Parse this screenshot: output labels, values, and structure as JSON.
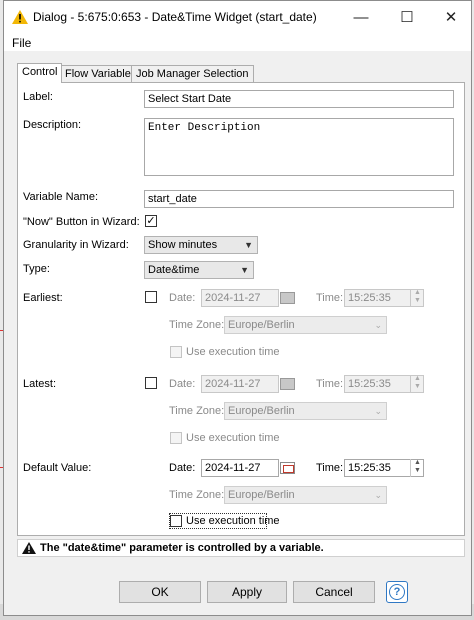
{
  "window": {
    "title": "Dialog - 5:675:0:653 - Date&Time Widget (start_date)",
    "minimize_glyph": "—",
    "maximize_glyph": "☐",
    "close_glyph": "✕"
  },
  "menu": {
    "file": "File"
  },
  "tabs": [
    "Control",
    "Flow Variables",
    "Job Manager Selection"
  ],
  "form": {
    "label_label": "Label:",
    "label_value": "Select Start Date",
    "description_label": "Description:",
    "description_value": "Enter Description",
    "variable_name_label": "Variable Name:",
    "variable_name_value": "start_date",
    "now_button_label": "\"Now\" Button in Wizard:",
    "now_button_checked": "✓",
    "granularity_label": "Granularity in Wizard:",
    "granularity_value": "Show minutes",
    "type_label": "Type:",
    "type_value": "Date&time",
    "date_label": "Date:",
    "time_label": "Time:",
    "timezone_label": "Time Zone:",
    "use_execution_time": "Use execution time",
    "earliest": {
      "label": "Earliest:",
      "date": "2024-11-27",
      "time": "15:25:35",
      "timezone": "Europe/Berlin"
    },
    "latest": {
      "label": "Latest:",
      "date": "2024-11-27",
      "time": "15:25:35",
      "timezone": "Europe/Berlin"
    },
    "default": {
      "label": "Default Value:",
      "date": "2024-11-27",
      "time": "15:25:35",
      "timezone": "Europe/Berlin"
    }
  },
  "status": {
    "message": "The \"date&time\" parameter is controlled by a variable."
  },
  "buttons": {
    "ok": "OK",
    "apply": "Apply",
    "cancel": "Cancel",
    "help": "?"
  },
  "colors": {
    "accent": "#2f78c4",
    "warning": "#f2b705"
  }
}
